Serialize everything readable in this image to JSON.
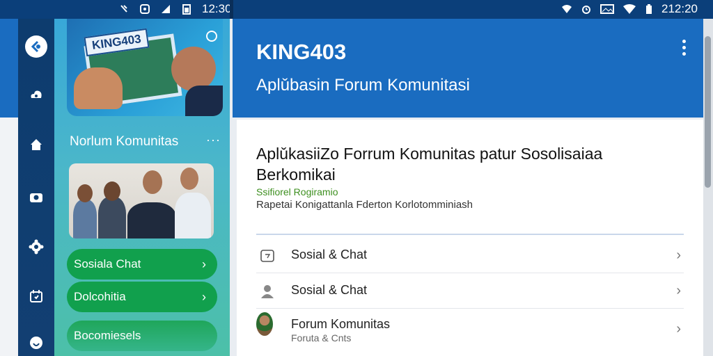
{
  "status_bar": {
    "left_time": "12:30",
    "right_time": "212:20"
  },
  "app": {
    "title": "KING403",
    "subtitle": "Aplǔbasin Forum Komunitasi"
  },
  "drawer": {
    "hero_label": "KING403",
    "title": "Norlum Komunitas",
    "more": "···",
    "pills": [
      {
        "label": "Sosiala Chat",
        "chevron": "›"
      },
      {
        "label": "Dolcohitia",
        "chevron": "›"
      },
      {
        "label": "Bocomiesels"
      }
    ]
  },
  "nav_rail": {
    "items": [
      "back-icon",
      "cloud-icon",
      "home-icon",
      "camera-icon",
      "settings-icon",
      "calendar-icon",
      "profile-icon"
    ]
  },
  "content": {
    "headline": "AplǔkasiiZo Forrum Komunitas patur Sosolisaiaa Berkomikai",
    "meta_category": "Ssifiorel Rogiramio",
    "meta_desc": "Rapetai Konigattanla Fderton Korlotomminiash",
    "rows": [
      {
        "label": "Sosial & Chat",
        "icon": "chat-icon",
        "chevron": "›"
      },
      {
        "label": "Sosial & Chat",
        "icon": "person-icon",
        "chevron": "›"
      },
      {
        "label": "Forum Komunitas",
        "sub": "Foruta & Cnts",
        "icon": "avatar-icon",
        "chevron": "›"
      }
    ]
  },
  "colors": {
    "header_blue": "#1a6cc0",
    "status_bar": "#0b3f7a",
    "nav_rail": "#0d3c6e",
    "pill_green": "#11a04d"
  }
}
